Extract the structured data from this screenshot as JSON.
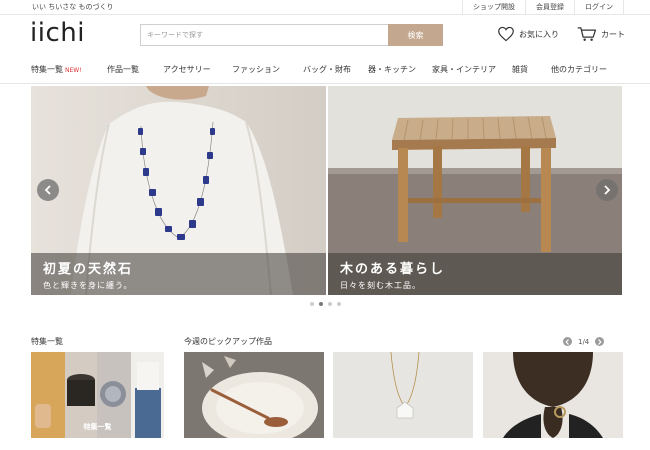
{
  "header": {
    "tagline": "いい ちいさな ものづくり",
    "top_links": [
      "ショップ開設",
      "会員登録",
      "ログイン"
    ],
    "logo": "iichi",
    "search_placeholder": "キーワードで探す",
    "search_button": "検索",
    "favorites_label": "お気に入り",
    "cart_label": "カート"
  },
  "nav": {
    "items": [
      "特集一覧",
      "作品一覧",
      "アクセサリー",
      "ファッション",
      "バッグ・財布",
      "器・キッチン",
      "家具・インテリア",
      "雑貨",
      "他のカテゴリー"
    ],
    "new_badge": "NEW!"
  },
  "hero": {
    "slides": [
      {
        "title": "初夏の天然石",
        "subtitle": "色と輝きを身に纏う。"
      },
      {
        "title": "木のある暮らし",
        "subtitle": "日々を刻む木工品。"
      }
    ],
    "dot_count": 4,
    "active_dot": 1
  },
  "sections": {
    "features_title": "特集一覧",
    "feature_tile_label": "特集一覧",
    "pickup_title": "今週のピックアップ作品",
    "pickup_page": "1/4"
  },
  "colors": {
    "search_button": "#c3a88f",
    "new_badge": "#dd3333"
  }
}
